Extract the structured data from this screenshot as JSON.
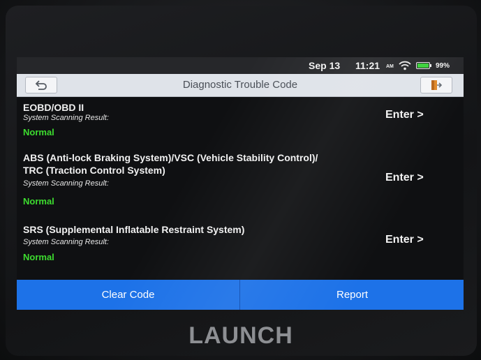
{
  "status_bar": {
    "date": "Sep 13",
    "time": "11:21",
    "ampm": "AM",
    "battery_pct": "99%",
    "battery_level": 0.99,
    "icons": [
      "wifi-icon",
      "battery-icon"
    ]
  },
  "header": {
    "title": "Diagnostic Trouble Code",
    "back_icon": "back-arrow-icon",
    "exit_icon": "exit-icon"
  },
  "systems": [
    {
      "name_line1": "EOBD/OBD II",
      "name_line2": "",
      "subtitle": "System Scanning Result:",
      "status": "Normal",
      "enter": "Enter >"
    },
    {
      "name_line1": "ABS (Anti-lock Braking System)/VSC (Vehicle Stability Control)/",
      "name_line2": "TRC (Traction Control System)",
      "subtitle": "System Scanning Result:",
      "status": "Normal",
      "enter": "Enter >"
    },
    {
      "name_line1": "SRS (Supplemental Inflatable Restraint System)",
      "name_line2": "",
      "subtitle": "System Scanning Result:",
      "status": "Normal",
      "enter": "Enter >"
    }
  ],
  "footer": {
    "clear_label": "Clear Code",
    "report_label": "Report"
  },
  "device": {
    "brand": "LAUNCH"
  },
  "colors": {
    "accent": "#1d72e8",
    "status_normal": "#3ddc2f",
    "titlebar_bg": "#dfe3e9"
  }
}
